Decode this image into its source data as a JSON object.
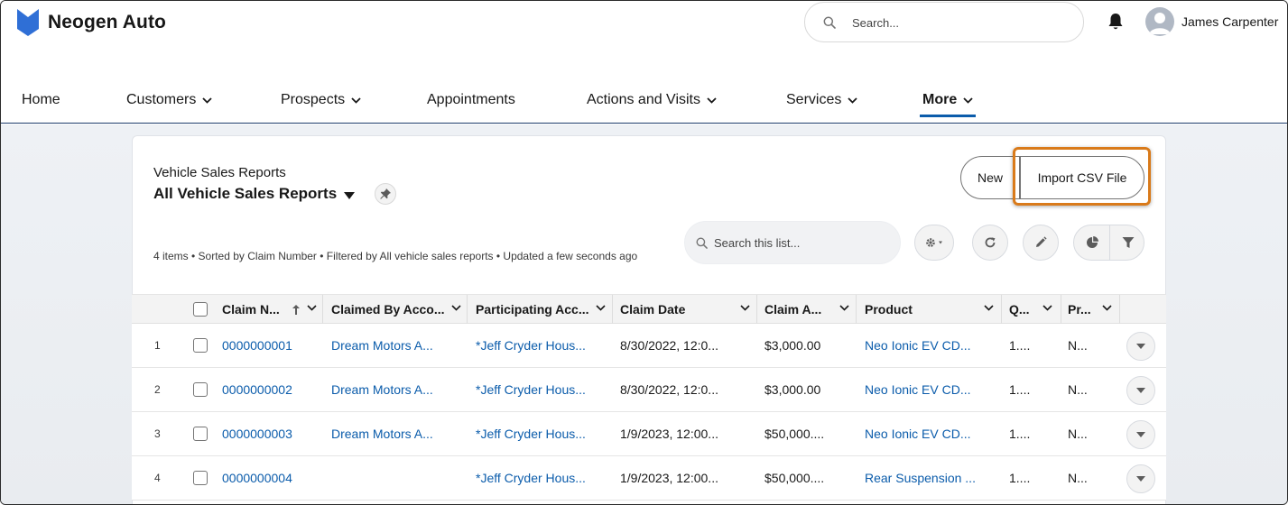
{
  "app": {
    "name": "Neogen Auto",
    "brand_color": "#2f6fd6"
  },
  "header": {
    "search_placeholder": "Search...",
    "user_name": "James Carpenter",
    "icons": [
      "search-icon",
      "bell-icon",
      "avatar"
    ]
  },
  "nav": {
    "items": [
      {
        "label": "Home",
        "has_menu": false,
        "active": false
      },
      {
        "label": "Customers",
        "has_menu": true,
        "active": false
      },
      {
        "label": "Prospects",
        "has_menu": true,
        "active": false
      },
      {
        "label": "Appointments",
        "has_menu": false,
        "active": false
      },
      {
        "label": "Actions and Visits",
        "has_menu": true,
        "active": false
      },
      {
        "label": "Services",
        "has_menu": true,
        "active": false
      },
      {
        "label": "More",
        "has_menu": true,
        "active": true
      }
    ]
  },
  "list_view": {
    "object_label": "Vehicle Sales Reports",
    "title": "All Vehicle Sales Reports",
    "status": "4 items • Sorted by Claim Number • Filtered by All vehicle sales reports • Updated a few seconds ago",
    "search_placeholder": "Search this list...",
    "buttons": {
      "new": "New",
      "import": "Import CSV File"
    },
    "highlight_color": "#d97a1a",
    "toolbar_icons": [
      "gear-icon",
      "refresh-icon",
      "edit-icon",
      "chart-icon",
      "filter-icon"
    ]
  },
  "table": {
    "columns": [
      {
        "label": "Claim N...",
        "sorted": "asc"
      },
      {
        "label": "Claimed By Acco..."
      },
      {
        "label": "Participating Acc..."
      },
      {
        "label": "Claim Date"
      },
      {
        "label": "Claim A..."
      },
      {
        "label": "Product"
      },
      {
        "label": "Q..."
      },
      {
        "label": "Pr..."
      }
    ],
    "rows": [
      {
        "num": "1",
        "claim": "0000000001",
        "claimed_by": "Dream Motors A...",
        "participating": "*Jeff Cryder Hous...",
        "date": "8/30/2022, 12:0...",
        "amount": "$3,000.00",
        "product": "Neo Ionic EV CD...",
        "q": "1....",
        "pr": "N..."
      },
      {
        "num": "2",
        "claim": "0000000002",
        "claimed_by": "Dream Motors A...",
        "participating": "*Jeff Cryder Hous...",
        "date": "8/30/2022, 12:0...",
        "amount": "$3,000.00",
        "product": "Neo Ionic EV CD...",
        "q": "1....",
        "pr": "N..."
      },
      {
        "num": "3",
        "claim": "0000000003",
        "claimed_by": "Dream Motors A...",
        "participating": "*Jeff Cryder Hous...",
        "date": "1/9/2023, 12:00...",
        "amount": "$50,000....",
        "product": "Neo Ionic EV CD...",
        "q": "1....",
        "pr": "N..."
      },
      {
        "num": "4",
        "claim": "0000000004",
        "claimed_by": "",
        "participating": "*Jeff Cryder Hous...",
        "date": "1/9/2023, 12:00...",
        "amount": "$50,000....",
        "product": "Rear Suspension ...",
        "q": "1....",
        "pr": "N..."
      }
    ]
  }
}
